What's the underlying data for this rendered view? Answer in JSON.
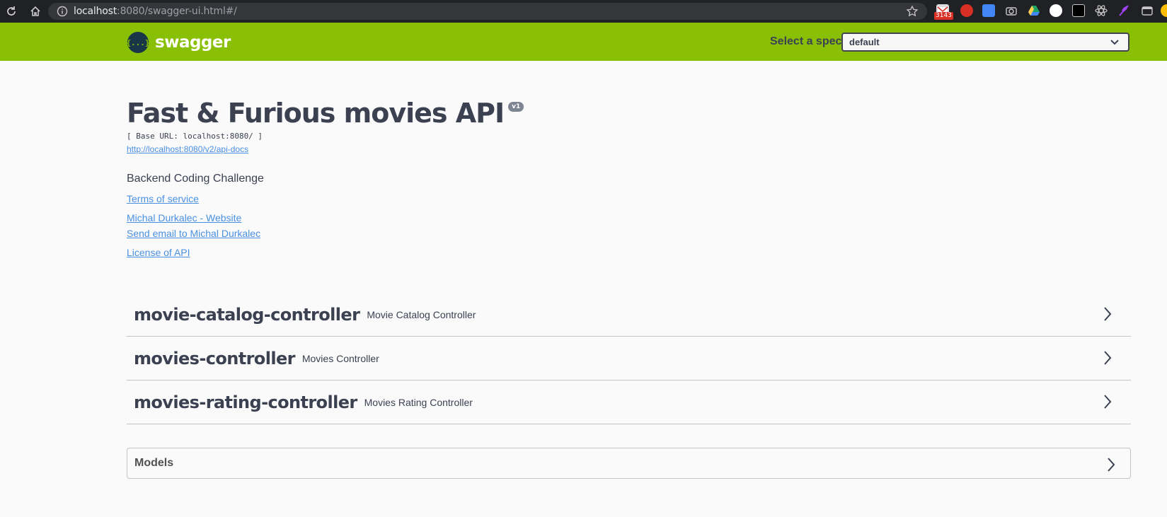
{
  "browser": {
    "url_host": "localhost",
    "url_rest": ":8080/swagger-ui.html#/",
    "mail_badge": "3143"
  },
  "topbar": {
    "logo_symbol": "{...}",
    "logo_text": "swagger",
    "spec_label": "Select a spec",
    "spec_value": "default"
  },
  "info": {
    "title": "Fast & Furious movies API",
    "version": "v1",
    "base_url": "[ Base URL: localhost:8080/ ]",
    "api_docs_link": "http://localhost:8080/v2/api-docs",
    "description": "Backend Coding Challenge",
    "terms_link": "Terms of service",
    "website_link": "Michal Durkalec - Website",
    "email_link": "Send email to Michal Durkalec",
    "license_link": "License of API"
  },
  "tags": [
    {
      "name": "movie-catalog-controller",
      "description": "Movie Catalog Controller"
    },
    {
      "name": "movies-controller",
      "description": "Movies Controller"
    },
    {
      "name": "movies-rating-controller",
      "description": "Movies Rating Controller"
    }
  ],
  "models": {
    "label": "Models"
  },
  "colors": {
    "topbar": "#89bf04",
    "link": "#4990e2",
    "text": "#3b4151"
  }
}
